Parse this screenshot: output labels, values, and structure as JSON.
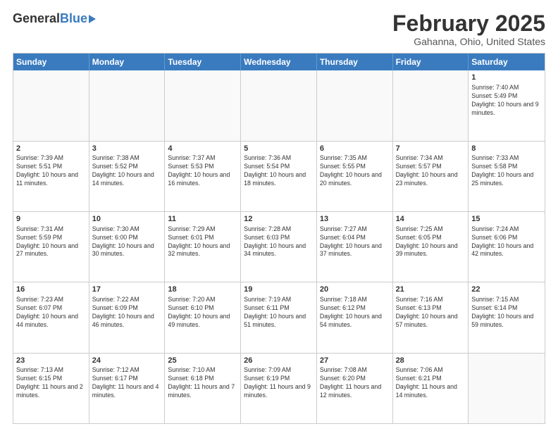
{
  "logo": {
    "general": "General",
    "blue": "Blue"
  },
  "title": "February 2025",
  "location": "Gahanna, Ohio, United States",
  "days_of_week": [
    "Sunday",
    "Monday",
    "Tuesday",
    "Wednesday",
    "Thursday",
    "Friday",
    "Saturday"
  ],
  "weeks": [
    [
      {
        "day": "",
        "info": ""
      },
      {
        "day": "",
        "info": ""
      },
      {
        "day": "",
        "info": ""
      },
      {
        "day": "",
        "info": ""
      },
      {
        "day": "",
        "info": ""
      },
      {
        "day": "",
        "info": ""
      },
      {
        "day": "1",
        "info": "Sunrise: 7:40 AM\nSunset: 5:49 PM\nDaylight: 10 hours and 9 minutes."
      }
    ],
    [
      {
        "day": "2",
        "info": "Sunrise: 7:39 AM\nSunset: 5:51 PM\nDaylight: 10 hours and 11 minutes."
      },
      {
        "day": "3",
        "info": "Sunrise: 7:38 AM\nSunset: 5:52 PM\nDaylight: 10 hours and 14 minutes."
      },
      {
        "day": "4",
        "info": "Sunrise: 7:37 AM\nSunset: 5:53 PM\nDaylight: 10 hours and 16 minutes."
      },
      {
        "day": "5",
        "info": "Sunrise: 7:36 AM\nSunset: 5:54 PM\nDaylight: 10 hours and 18 minutes."
      },
      {
        "day": "6",
        "info": "Sunrise: 7:35 AM\nSunset: 5:55 PM\nDaylight: 10 hours and 20 minutes."
      },
      {
        "day": "7",
        "info": "Sunrise: 7:34 AM\nSunset: 5:57 PM\nDaylight: 10 hours and 23 minutes."
      },
      {
        "day": "8",
        "info": "Sunrise: 7:33 AM\nSunset: 5:58 PM\nDaylight: 10 hours and 25 minutes."
      }
    ],
    [
      {
        "day": "9",
        "info": "Sunrise: 7:31 AM\nSunset: 5:59 PM\nDaylight: 10 hours and 27 minutes."
      },
      {
        "day": "10",
        "info": "Sunrise: 7:30 AM\nSunset: 6:00 PM\nDaylight: 10 hours and 30 minutes."
      },
      {
        "day": "11",
        "info": "Sunrise: 7:29 AM\nSunset: 6:01 PM\nDaylight: 10 hours and 32 minutes."
      },
      {
        "day": "12",
        "info": "Sunrise: 7:28 AM\nSunset: 6:03 PM\nDaylight: 10 hours and 34 minutes."
      },
      {
        "day": "13",
        "info": "Sunrise: 7:27 AM\nSunset: 6:04 PM\nDaylight: 10 hours and 37 minutes."
      },
      {
        "day": "14",
        "info": "Sunrise: 7:25 AM\nSunset: 6:05 PM\nDaylight: 10 hours and 39 minutes."
      },
      {
        "day": "15",
        "info": "Sunrise: 7:24 AM\nSunset: 6:06 PM\nDaylight: 10 hours and 42 minutes."
      }
    ],
    [
      {
        "day": "16",
        "info": "Sunrise: 7:23 AM\nSunset: 6:07 PM\nDaylight: 10 hours and 44 minutes."
      },
      {
        "day": "17",
        "info": "Sunrise: 7:22 AM\nSunset: 6:09 PM\nDaylight: 10 hours and 46 minutes."
      },
      {
        "day": "18",
        "info": "Sunrise: 7:20 AM\nSunset: 6:10 PM\nDaylight: 10 hours and 49 minutes."
      },
      {
        "day": "19",
        "info": "Sunrise: 7:19 AM\nSunset: 6:11 PM\nDaylight: 10 hours and 51 minutes."
      },
      {
        "day": "20",
        "info": "Sunrise: 7:18 AM\nSunset: 6:12 PM\nDaylight: 10 hours and 54 minutes."
      },
      {
        "day": "21",
        "info": "Sunrise: 7:16 AM\nSunset: 6:13 PM\nDaylight: 10 hours and 57 minutes."
      },
      {
        "day": "22",
        "info": "Sunrise: 7:15 AM\nSunset: 6:14 PM\nDaylight: 10 hours and 59 minutes."
      }
    ],
    [
      {
        "day": "23",
        "info": "Sunrise: 7:13 AM\nSunset: 6:15 PM\nDaylight: 11 hours and 2 minutes."
      },
      {
        "day": "24",
        "info": "Sunrise: 7:12 AM\nSunset: 6:17 PM\nDaylight: 11 hours and 4 minutes."
      },
      {
        "day": "25",
        "info": "Sunrise: 7:10 AM\nSunset: 6:18 PM\nDaylight: 11 hours and 7 minutes."
      },
      {
        "day": "26",
        "info": "Sunrise: 7:09 AM\nSunset: 6:19 PM\nDaylight: 11 hours and 9 minutes."
      },
      {
        "day": "27",
        "info": "Sunrise: 7:08 AM\nSunset: 6:20 PM\nDaylight: 11 hours and 12 minutes."
      },
      {
        "day": "28",
        "info": "Sunrise: 7:06 AM\nSunset: 6:21 PM\nDaylight: 11 hours and 14 minutes."
      },
      {
        "day": "",
        "info": ""
      }
    ]
  ]
}
